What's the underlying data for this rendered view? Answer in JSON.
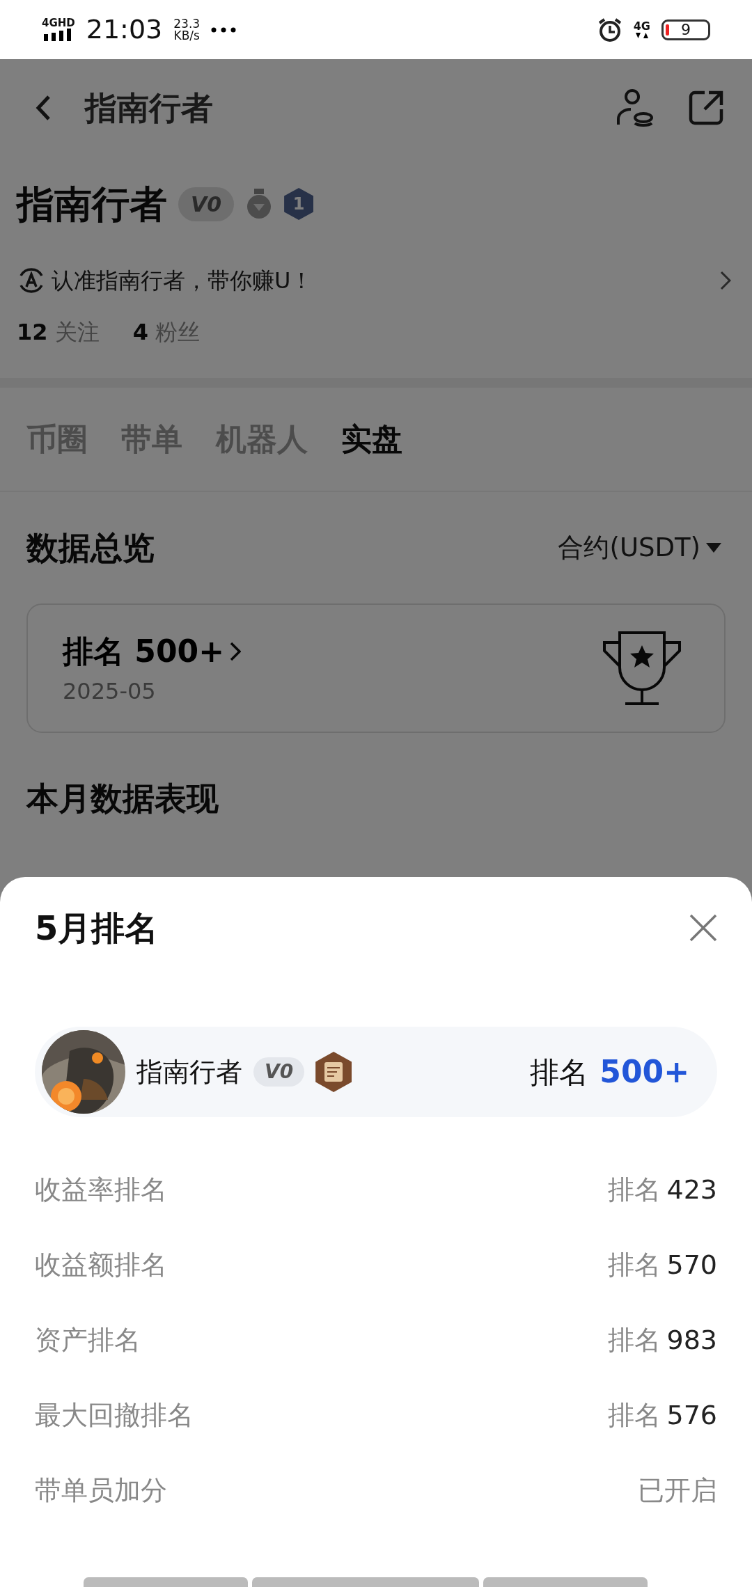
{
  "status_bar": {
    "network": "4GHD",
    "time": "21:03",
    "speed": "23.3",
    "speed_unit": "KB/s",
    "network_right": "4G",
    "battery": "9"
  },
  "header": {
    "title": "指南行者"
  },
  "profile": {
    "name": "指南行者",
    "level": "V0",
    "rank_badge": "1",
    "bio": "认准指南行者，带你赚U！",
    "following_count": "12",
    "following_label": "关注",
    "fans_count": "4",
    "fans_label": "粉丝"
  },
  "tabs": [
    {
      "label": "币圈",
      "selected": false
    },
    {
      "label": "带单",
      "selected": false
    },
    {
      "label": "机器人",
      "selected": false
    },
    {
      "label": "实盘",
      "selected": true
    }
  ],
  "overview": {
    "title": "数据总览",
    "selector": "合约(USDT)",
    "rank_label": "排名",
    "rank_value": "500+",
    "date": "2025-05"
  },
  "month_title": "本月数据表现",
  "sheet": {
    "title": "5月排名",
    "user": {
      "name": "指南行者",
      "level": "V0",
      "rank_label": "排名",
      "rank_value": "500+"
    },
    "rows": [
      {
        "kind": "rank",
        "label": "收益率排名",
        "prefix": "排名",
        "value": "423"
      },
      {
        "kind": "rank",
        "label": "收益额排名",
        "prefix": "排名",
        "value": "570"
      },
      {
        "kind": "rank",
        "label": "资产排名",
        "prefix": "排名",
        "value": "983"
      },
      {
        "kind": "rank",
        "label": "最大回撤排名",
        "prefix": "排名",
        "value": "576"
      },
      {
        "kind": "status",
        "label": "带单员加分",
        "value": "已开启"
      }
    ]
  }
}
